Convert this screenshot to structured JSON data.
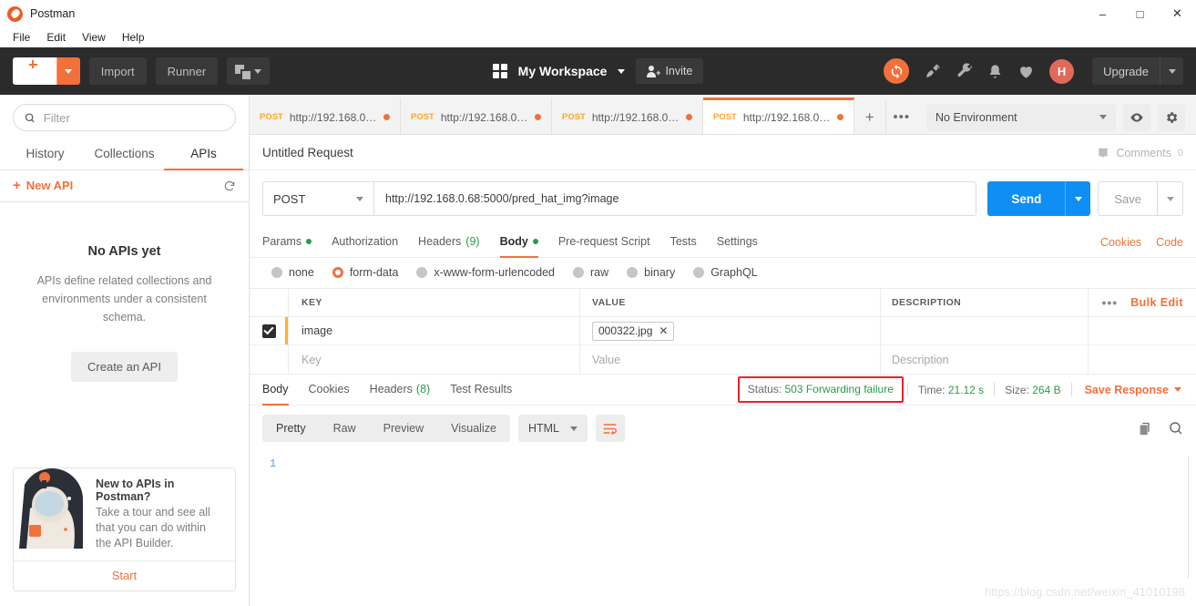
{
  "window": {
    "app_title": "Postman",
    "controls": {
      "minimize": "–",
      "maximize": "□",
      "close": "✕"
    }
  },
  "menubar": {
    "items": [
      "File",
      "Edit",
      "View",
      "Help"
    ]
  },
  "toolbar": {
    "new_label": "New",
    "import_label": "Import",
    "runner_label": "Runner",
    "workspace_label": "My Workspace",
    "invite_label": "Invite",
    "upgrade_label": "Upgrade",
    "avatar_initial": "H",
    "icons": [
      "sync-icon",
      "satellite-icon",
      "wrench-icon",
      "bell-icon",
      "heart-icon"
    ]
  },
  "sidebar": {
    "filter_placeholder": "Filter",
    "filter_value": "",
    "tabs": [
      {
        "label": "History",
        "active": false
      },
      {
        "label": "Collections",
        "active": false
      },
      {
        "label": "APIs",
        "active": true
      }
    ],
    "new_api_label": "New API",
    "empty": {
      "title": "No APIs yet",
      "description": "APIs define related collections and environments under a consistent schema.",
      "button": "Create an API"
    },
    "promo": {
      "heading": "New to APIs in Postman?",
      "body": "Take a tour and see all that you can do within the API Builder.",
      "action": "Start"
    }
  },
  "tabbar": {
    "tabs": [
      {
        "method": "POST",
        "url": "http://192.168.0.1...",
        "active": false,
        "unsaved": true
      },
      {
        "method": "POST",
        "url": "http://192.168.0.1...",
        "active": false,
        "unsaved": true
      },
      {
        "method": "POST",
        "url": "http://192.168.0.6...",
        "active": false,
        "unsaved": true
      },
      {
        "method": "POST",
        "url": "http://192.168.0.6...",
        "active": true,
        "unsaved": true
      }
    ],
    "add_label": "+",
    "more_label": "•••",
    "environment": "No Environment"
  },
  "request": {
    "title": "Untitled Request",
    "comments_label": "Comments",
    "comments_count": "0",
    "method": "POST",
    "url": "http://192.168.0.68:5000/pred_hat_img?image",
    "send_label": "Send",
    "save_label": "Save",
    "tabs": [
      {
        "label": "Params",
        "dot": true,
        "count": "",
        "active": false
      },
      {
        "label": "Authorization",
        "dot": false,
        "count": "",
        "active": false
      },
      {
        "label": "Headers",
        "dot": false,
        "count": "(9)",
        "active": false
      },
      {
        "label": "Body",
        "dot": true,
        "count": "",
        "active": true
      },
      {
        "label": "Pre-request Script",
        "dot": false,
        "count": "",
        "active": false
      },
      {
        "label": "Tests",
        "dot": false,
        "count": "",
        "active": false
      },
      {
        "label": "Settings",
        "dot": false,
        "count": "",
        "active": false
      }
    ],
    "right_links": [
      "Cookies",
      "Code"
    ],
    "body_types": [
      {
        "label": "none",
        "selected": false
      },
      {
        "label": "form-data",
        "selected": true
      },
      {
        "label": "x-www-form-urlencoded",
        "selected": false
      },
      {
        "label": "raw",
        "selected": false
      },
      {
        "label": "binary",
        "selected": false
      },
      {
        "label": "GraphQL",
        "selected": false
      }
    ],
    "table": {
      "headers": [
        "KEY",
        "VALUE",
        "DESCRIPTION"
      ],
      "more_label": "•••",
      "bulk_edit_label": "Bulk Edit",
      "rows": [
        {
          "checked": true,
          "key": "image",
          "file_chip": "000322.jpg",
          "chip_remove": "✕",
          "description": ""
        }
      ],
      "placeholder_row": {
        "key": "Key",
        "value": "Value",
        "description": "Description"
      }
    }
  },
  "response": {
    "tabs": [
      {
        "label": "Body",
        "count": "",
        "active": true
      },
      {
        "label": "Cookies",
        "count": "",
        "active": false
      },
      {
        "label": "Headers",
        "count": "(8)",
        "active": false
      },
      {
        "label": "Test Results",
        "count": "",
        "active": false
      }
    ],
    "status_label": "Status:",
    "status_value": "503 Forwarding failure",
    "time_label": "Time:",
    "time_value": "21.12 s",
    "size_label": "Size:",
    "size_value": "264 B",
    "save_response_label": "Save Response",
    "viewer_tabs": [
      {
        "label": "Pretty",
        "active": true
      },
      {
        "label": "Raw",
        "active": false
      },
      {
        "label": "Preview",
        "active": false
      },
      {
        "label": "Visualize",
        "active": false
      }
    ],
    "format": "HTML",
    "line_numbers": [
      "1"
    ],
    "body_lines": [
      ""
    ]
  },
  "watermark": "https://blog.csdn.net/weixin_41010198",
  "colors": {
    "accent_orange": "#f2713b",
    "send_blue": "#0f8ff3",
    "status_green": "#2a9b48",
    "highlight_red": "#e8222a",
    "toolbar_dark": "#2b2b2b"
  }
}
